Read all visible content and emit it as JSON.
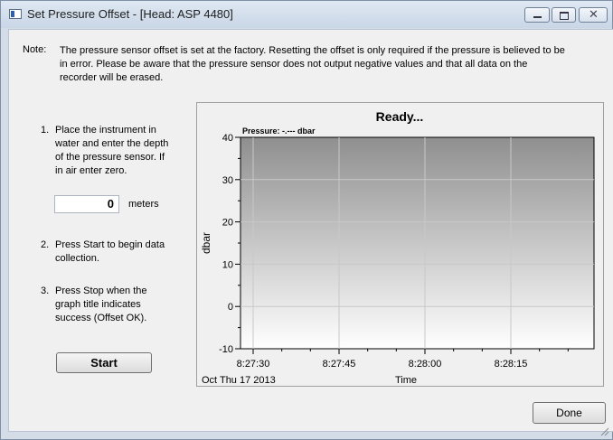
{
  "window": {
    "title": "Set Pressure Offset - [Head: ASP 4480]",
    "close_glyph": "✕"
  },
  "note": {
    "label": "Note:",
    "text": "The pressure sensor offset is set at the factory. Resetting the offset is only required if the pressure is believed to be in error. Please be aware that the pressure sensor does not output negative values and that all data on the recorder will be erased."
  },
  "steps": [
    {
      "num": "1.",
      "text": "Place the instrument in water and enter the depth of the pressure sensor. If in air enter zero."
    },
    {
      "num": "2.",
      "text": "Press Start to begin data collection."
    },
    {
      "num": "3.",
      "text": "Press Stop when the graph title indicates success (Offset OK)."
    }
  ],
  "depth": {
    "value": "0",
    "units": "meters"
  },
  "buttons": {
    "start": "Start",
    "done": "Done"
  },
  "chart_data": {
    "type": "line",
    "title": "Ready...",
    "subtitle": "Pressure: -.--- dbar",
    "ylabel": "dbar",
    "xlabel": "Time",
    "ylim": [
      -10,
      40
    ],
    "yticks": [
      "40",
      "30",
      "20",
      "10",
      "0",
      "-10"
    ],
    "xticks": [
      "8:27:30",
      "8:27:45",
      "8:28:00",
      "8:28:15"
    ],
    "date_label": "Oct Thu 17 2013",
    "series": [],
    "grid": true,
    "plot_gradient": [
      "#8f8f8f",
      "#ffffff"
    ]
  }
}
